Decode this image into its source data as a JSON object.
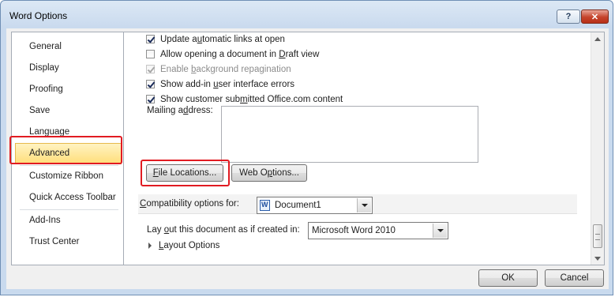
{
  "window": {
    "title": "Word Options",
    "help_label": "?",
    "close_label": "✕"
  },
  "sidebar": {
    "items": [
      {
        "label": "General"
      },
      {
        "label": "Display"
      },
      {
        "label": "Proofing"
      },
      {
        "label": "Save"
      },
      {
        "label": "Language"
      },
      {
        "label": "Advanced"
      },
      {
        "label": "Customize Ribbon"
      },
      {
        "label": "Quick Access Toolbar"
      },
      {
        "label": "Add-Ins"
      },
      {
        "label": "Trust Center"
      }
    ]
  },
  "options": {
    "update_links": {
      "label_pre": "Update a",
      "label_u": "u",
      "label_post": "tomatic links at open",
      "checked": true
    },
    "draft_view": {
      "label_pre": "Allow opening a document in ",
      "label_u": "D",
      "label_post": "raft view",
      "checked": false
    },
    "bg_repagination": {
      "label_pre": "Enable ",
      "label_u": "b",
      "label_post": "ackground repagination",
      "checked": true,
      "disabled": true
    },
    "addin_errors": {
      "label_pre": "Show add-in ",
      "label_u": "u",
      "label_post": "ser interface errors",
      "checked": true
    },
    "customer_content": {
      "label_pre": "Show customer sub",
      "label_u": "m",
      "label_post": "itted Office.com content",
      "checked": true
    },
    "mailing_address": {
      "label_pre": "Mailing a",
      "label_u": "d",
      "label_post": "dress:",
      "value": ""
    }
  },
  "buttons": {
    "file_locations": {
      "u": "F",
      "rest": "ile Locations..."
    },
    "web_options": {
      "pre": "Web O",
      "u": "p",
      "rest": "tions..."
    },
    "ok": "OK",
    "cancel": "Cancel"
  },
  "compatibility": {
    "label_u": "C",
    "label_rest": "ompatibility options for:",
    "document": "Document1",
    "layout_label_pre": "Lay ",
    "layout_label_u": "o",
    "layout_label_post": "ut this document as if created in:",
    "layout_value": "Microsoft Word 2010",
    "layout_options_pre": "",
    "layout_options_u": "L",
    "layout_options_post": "ayout Options"
  },
  "colors": {
    "highlight": "#e11b22",
    "active_nav": "#ffde7a"
  }
}
